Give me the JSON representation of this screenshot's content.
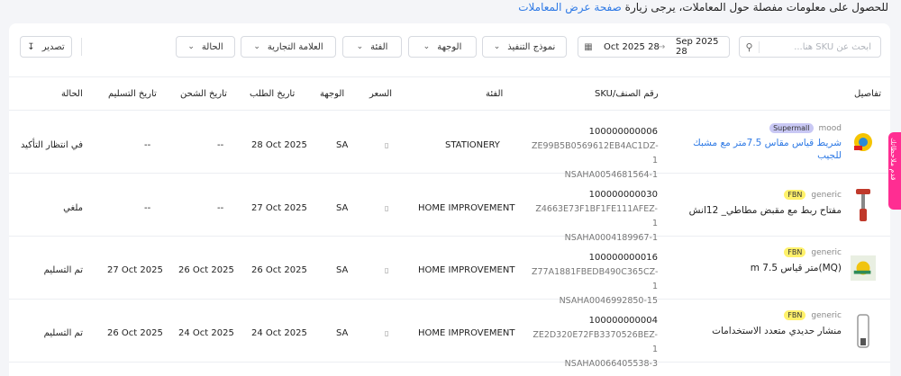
{
  "notice": {
    "text": "للحصول على معلومات مفصلة حول المعاملات، يرجى زيارة",
    "link": "صفحة عرض المعاملات"
  },
  "filters": {
    "search_placeholder": "ابحث عن SKU هنا...",
    "date_from": "Sep 2025 28",
    "date_to": "Oct 2025 28",
    "fulfillment": "نموذج التنفيذ",
    "destination": "الوجهة",
    "category": "الفئة",
    "brand": "العلامة التجارية",
    "status": "الحالة",
    "export": "تصدير"
  },
  "columns": {
    "details": "تفاصيل",
    "sku": "SKU/رقم الصنف",
    "category": "الفئة",
    "price": "السعر",
    "destination": "الوجهة",
    "order_date": "تاريخ الطلب",
    "ship_date": "تاريخ الشحن",
    "delivery_date": "تاريخ التسليم",
    "status": "الحالة"
  },
  "rows": [
    {
      "brand": "mood",
      "badge": "Supermall",
      "name": "شريط قياس مقاس 7.5متر مع مشبك للجيب",
      "sku": "100000000006",
      "sku_line2": "ZE99B5B0569612EB4AC1DZ-1",
      "sku_line3": "NSAHA0054681564-1",
      "category": "STATIONERY",
      "destination": "SA",
      "order_date": "28 Oct 2025",
      "ship_date": "--",
      "delivery_date": "--",
      "status": "في انتظار التأكيد"
    },
    {
      "brand": "generic",
      "badge": "FBN",
      "name": "مفتاح ربط مع مقبض مطاطي_ 12انش",
      "sku": "100000000030",
      "sku_line2": "Z4663E73F1BF1FE111AFEZ-1",
      "sku_line3": "NSAHA0004189967-1",
      "category": "HOME IMPROVEMENT",
      "destination": "SA",
      "order_date": "27 Oct 2025",
      "ship_date": "--",
      "delivery_date": "--",
      "status": "ملغي"
    },
    {
      "brand": "generic",
      "badge": "FBN",
      "name": "(MQ)متر قياس 7.5 m",
      "sku": "100000000016",
      "sku_line2": "Z77A1881FBEDB490C365CZ-1",
      "sku_line3": "NSAHA0046992850-15",
      "category": "HOME IMPROVEMENT",
      "destination": "SA",
      "order_date": "26 Oct 2025",
      "ship_date": "26 Oct 2025",
      "delivery_date": "27 Oct 2025",
      "status": "تم التسليم"
    },
    {
      "brand": "generic",
      "badge": "FBN",
      "name": "منشار حديدي متعدد الاستخدامات",
      "sku": "100000000004",
      "sku_line2": "ZE2D320E72FB3370526BEZ-1",
      "sku_line3": "NSAHA0066405538-3",
      "category": "HOME IMPROVEMENT",
      "destination": "SA",
      "order_date": "24 Oct 2025",
      "ship_date": "24 Oct 2025",
      "delivery_date": "26 Oct 2025",
      "status": "تم التسليم"
    }
  ],
  "side_tab": "قدم ملاحظاتك",
  "icons": [
    "search-icon",
    "calendar-icon",
    "chevron-down-icon",
    "download-icon",
    "price-icon"
  ],
  "colors": {
    "link": "#2f7ae5",
    "side_tab": "#ff2d92",
    "fbn_badge": "#fff16a",
    "supermall_badge": "#c9c8f4"
  }
}
